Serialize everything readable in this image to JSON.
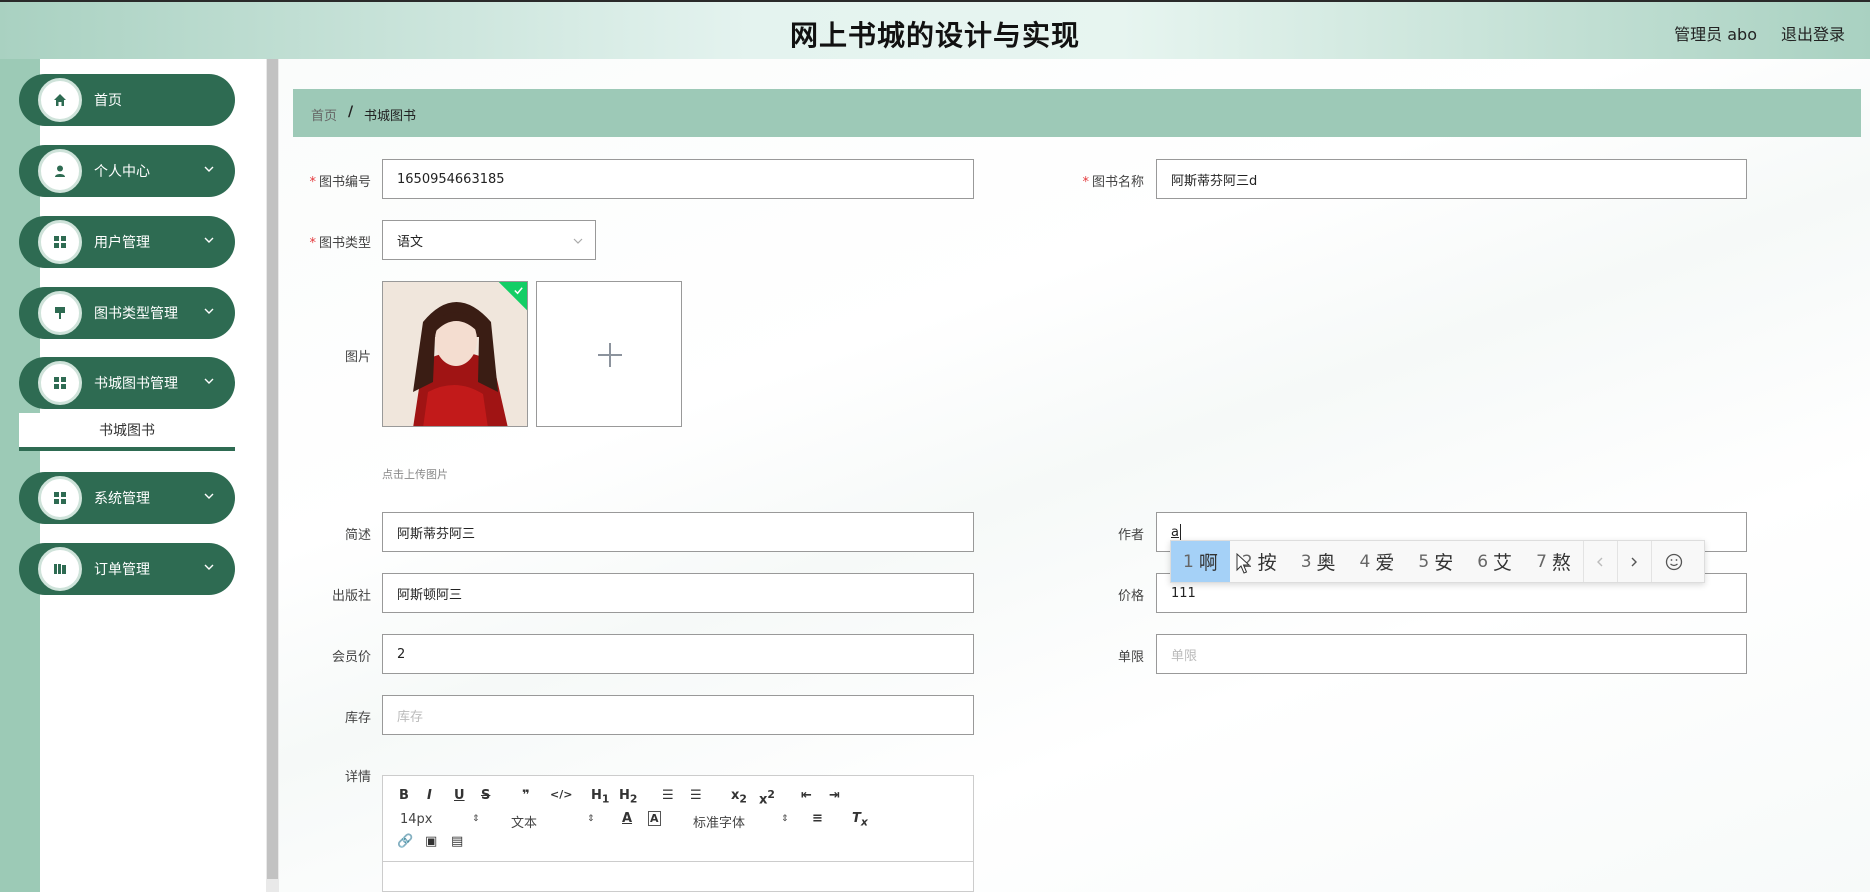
{
  "header": {
    "title": "网上书城的设计与实现",
    "user": "管理员 abo",
    "logout": "退出登录"
  },
  "sidebar": {
    "items": [
      {
        "label": "首页",
        "icon": "home-icon"
      },
      {
        "label": "个人中心",
        "icon": "user-icon"
      },
      {
        "label": "用户管理",
        "icon": "grid-icon"
      },
      {
        "label": "图书类型管理",
        "icon": "brush-icon"
      },
      {
        "label": "书城图书管理",
        "icon": "grid-icon"
      },
      {
        "label": "系统管理",
        "icon": "grid-icon"
      },
      {
        "label": "订单管理",
        "icon": "book-icon"
      }
    ],
    "submenu_label": "书城图书"
  },
  "breadcrumb": {
    "home": "首页",
    "separator": "/",
    "current": "书城图书"
  },
  "form": {
    "book_no": {
      "label": "图书编号",
      "value": "1650954663185"
    },
    "book_name": {
      "label": "图书名称",
      "value": "阿斯蒂芬阿三d"
    },
    "book_type": {
      "label": "图书类型",
      "value": "语文"
    },
    "image": {
      "label": "图片",
      "tip": "点击上传图片"
    },
    "summary": {
      "label": "简述",
      "value": "阿斯蒂芬阿三"
    },
    "author": {
      "label": "作者",
      "value": "a"
    },
    "publisher": {
      "label": "出版社",
      "value": "阿斯顿阿三"
    },
    "price": {
      "label": "价格",
      "value": "111"
    },
    "member_price": {
      "label": "会员价",
      "value": "2"
    },
    "limit": {
      "label": "单限",
      "placeholder": "单限"
    },
    "stock": {
      "label": "库存",
      "placeholder": "库存"
    },
    "details": {
      "label": "详情"
    }
  },
  "ime": {
    "candidates": [
      {
        "n": "1",
        "c": "啊"
      },
      {
        "n": "2",
        "c": "按"
      },
      {
        "n": "3",
        "c": "奥"
      },
      {
        "n": "4",
        "c": "爱"
      },
      {
        "n": "5",
        "c": "安"
      },
      {
        "n": "6",
        "c": "艾"
      },
      {
        "n": "7",
        "c": "熬"
      }
    ]
  },
  "editor": {
    "font_size": "14px",
    "text_style": "文本",
    "font_family": "标准字体"
  },
  "colors": {
    "sidebar_item": "#2e6b52",
    "breadcrumb_bg": "#9dc9b7",
    "required": "#e4393c"
  }
}
